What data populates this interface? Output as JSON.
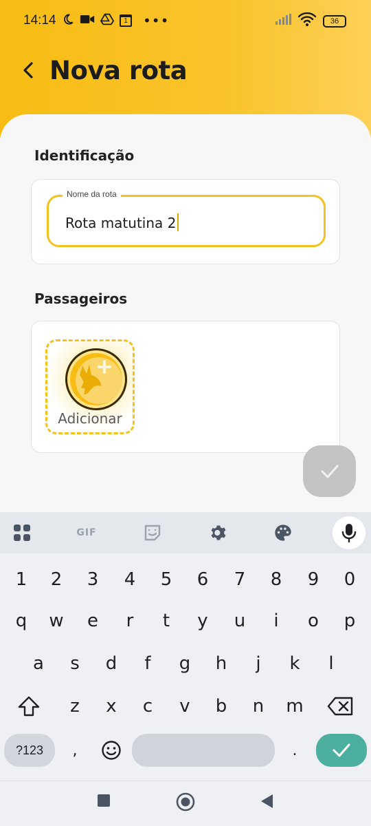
{
  "status_bar": {
    "time": "14:14",
    "icons_left": [
      "moon-icon",
      "video-icon",
      "drive-icon",
      "calendar-icon",
      "more-icon"
    ],
    "icons_right": [
      "signal-icon",
      "wifi-icon",
      "battery-icon"
    ],
    "battery_level": "36",
    "calendar_day": "1"
  },
  "header": {
    "title": "Nova rota",
    "accent_color": "#f7bd14"
  },
  "identification": {
    "section_title": "Identificação",
    "route_name_label": "Nome da rota",
    "route_name_value": "Rota matutina 2"
  },
  "passengers": {
    "section_title": "Passageiros",
    "add_label": "Adicionar"
  },
  "keyboard": {
    "toolbar": [
      "apps-icon",
      "GIF",
      "sticker-icon",
      "settings-icon",
      "palette-icon",
      "mic-icon"
    ],
    "gif_label": "GIF",
    "row_numbers": [
      "1",
      "2",
      "3",
      "4",
      "5",
      "6",
      "7",
      "8",
      "9",
      "0"
    ],
    "row_1": [
      "q",
      "w",
      "e",
      "r",
      "t",
      "y",
      "u",
      "i",
      "o",
      "p"
    ],
    "row_2": [
      "a",
      "s",
      "d",
      "f",
      "g",
      "h",
      "j",
      "k",
      "l"
    ],
    "row_3": [
      "z",
      "x",
      "c",
      "v",
      "b",
      "n",
      "m"
    ],
    "symbols_key": "?123",
    "comma_key": ",",
    "period_key": ".",
    "enter_color": "#4dafa0"
  }
}
